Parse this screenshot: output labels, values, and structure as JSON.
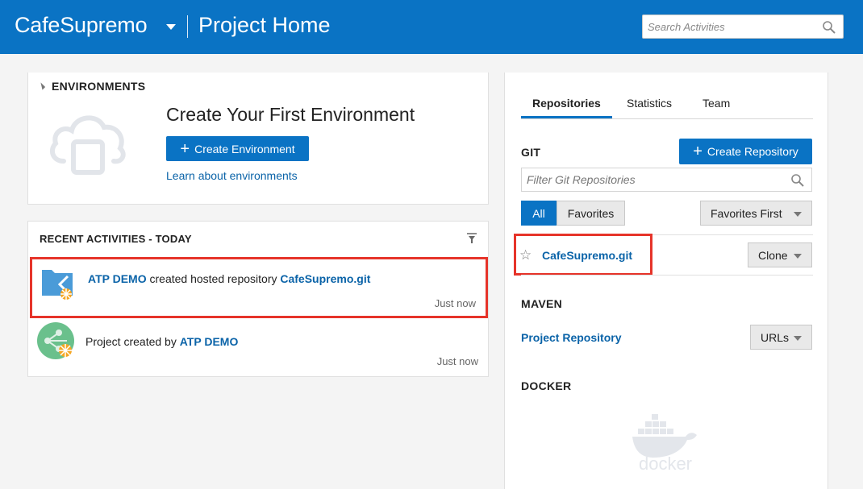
{
  "header": {
    "project_name": "CafeSupremo",
    "page_title": "Project Home",
    "search_placeholder": "Search Activities"
  },
  "environments": {
    "heading": "ENVIRONMENTS",
    "title": "Create Your First Environment",
    "create_button": "Create Environment",
    "learn_link": "Learn about environments"
  },
  "activities": {
    "heading": "RECENT ACTIVITIES - TODAY",
    "items": [
      {
        "actor": "ATP DEMO",
        "text": " created hosted repository ",
        "target": "CafeSupremo.git",
        "time": "Just now"
      },
      {
        "prefix": "Project created by ",
        "actor": "ATP DEMO",
        "time": "Just now"
      }
    ]
  },
  "repos": {
    "tabs": [
      "Repositories",
      "Statistics",
      "Team"
    ],
    "git_heading": "GIT",
    "create_button": "Create Repository",
    "filter_placeholder": "Filter Git Repositories",
    "seg_all": "All",
    "seg_favorites": "Favorites",
    "sort_dropdown": "Favorites First",
    "repo_name": "CafeSupremo.git",
    "clone_label": "Clone",
    "maven_heading": "MAVEN",
    "maven_link": "Project Repository",
    "urls_label": "URLs",
    "docker_heading": "DOCKER",
    "docker_logo_text": "docker"
  },
  "colors": {
    "header_bg": "#0a73c4",
    "link": "#0a63a8",
    "highlight": "#e6342a"
  }
}
